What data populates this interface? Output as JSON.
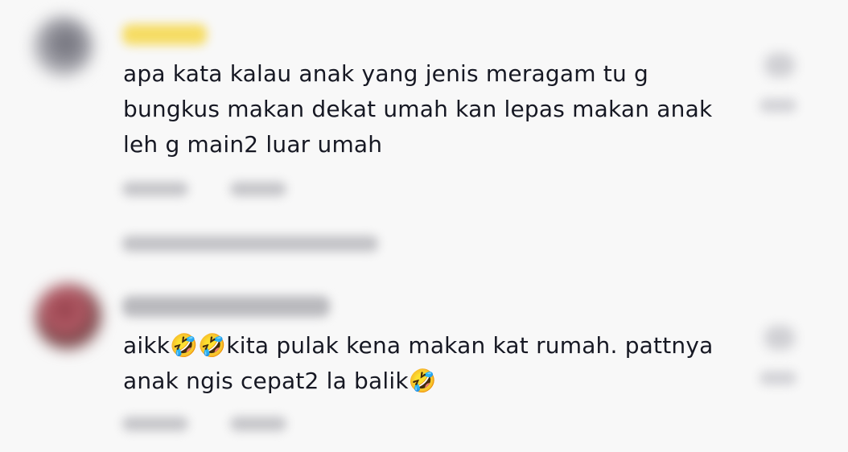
{
  "comments": [
    {
      "text_lines": [
        "apa kata kalau anak yang jenis meragam tu g",
        "bungkus makan dekat umah kan lepas makan anak",
        "leh g main2 luar umah"
      ]
    },
    {
      "text_lines": [
        "aikk🤣🤣kita pulak kena makan kat rumah. pattnya",
        "anak ngis cepat2 la balik🤣"
      ]
    }
  ]
}
